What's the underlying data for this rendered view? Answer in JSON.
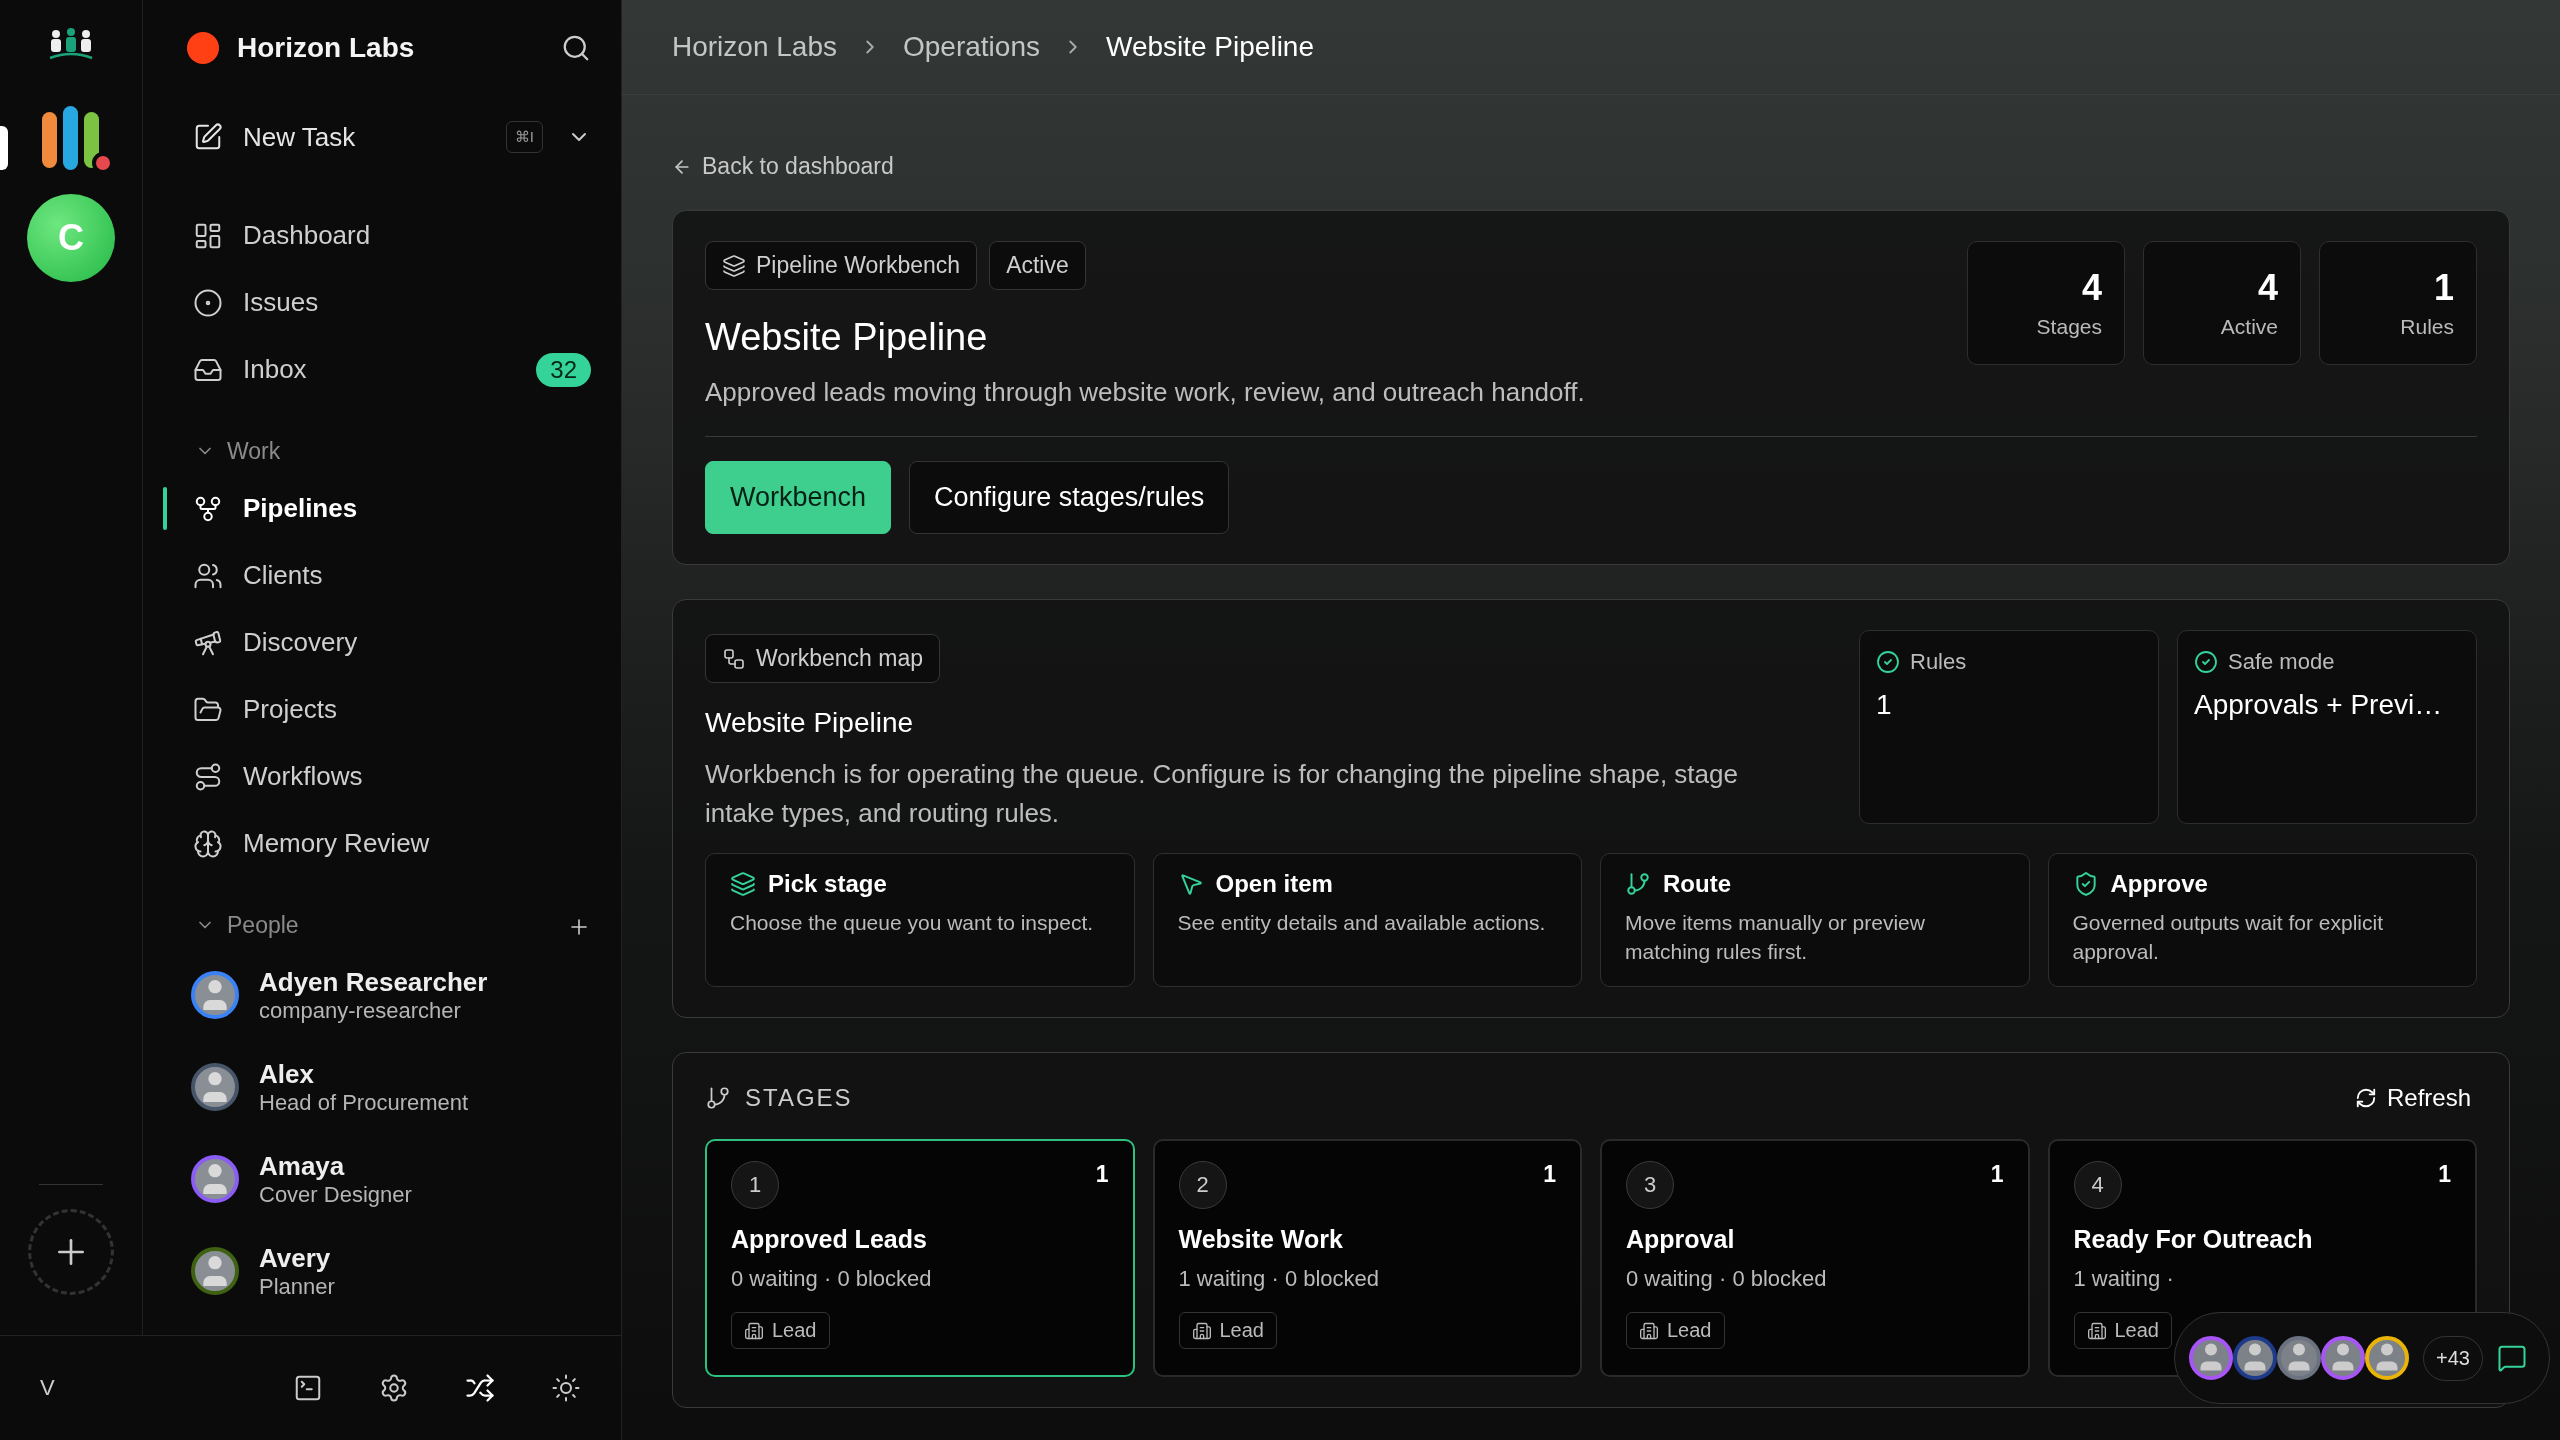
{
  "rail": {
    "notification": true,
    "avatar": "C"
  },
  "workspace": {
    "name": "Horizon Labs",
    "color": "#ff4015"
  },
  "new_task": {
    "label": "New Task",
    "shortcut": "⌘I"
  },
  "nav": [
    {
      "label": "Dashboard",
      "selected": false
    },
    {
      "label": "Issues",
      "selected": false
    },
    {
      "label": "Inbox",
      "selected": false,
      "badge": "32"
    }
  ],
  "work": {
    "title": "Work",
    "expanded": true,
    "items": [
      {
        "label": "Pipelines",
        "selected": true
      },
      {
        "label": "Clients",
        "selected": false
      },
      {
        "label": "Discovery",
        "selected": false
      },
      {
        "label": "Projects",
        "selected": false
      },
      {
        "label": "Workflows",
        "selected": false
      },
      {
        "label": "Memory Review",
        "selected": false
      }
    ]
  },
  "people": {
    "title": "People",
    "expanded": true,
    "items": [
      {
        "name": "Adyen Researcher",
        "role": "company-researcher",
        "color": "#3b82f6"
      },
      {
        "name": "Alex",
        "role": "Head of Procurement",
        "color": "#475569"
      },
      {
        "name": "Amaya",
        "role": "Cover Designer",
        "color": "#8b5cf6"
      },
      {
        "name": "Avery",
        "role": "Planner",
        "color": "#3f6212"
      }
    ]
  },
  "footer": {
    "label": "V"
  },
  "breadcrumb": [
    "Horizon Labs",
    "Operations",
    "Website Pipeline"
  ],
  "back_link": "Back to dashboard",
  "header": {
    "badges": [
      "Pipeline Workbench",
      "Active"
    ],
    "title": "Website Pipeline",
    "description": "Approved leads moving through website work, review, and outreach handoff.",
    "stats": [
      {
        "value": "4",
        "label": "Stages"
      },
      {
        "value": "4",
        "label": "Active"
      },
      {
        "value": "1",
        "label": "Rules"
      }
    ],
    "tabs": [
      {
        "label": "Workbench",
        "selected": true
      },
      {
        "label": "Configure stages/rules",
        "selected": false
      }
    ]
  },
  "map": {
    "badge": "Workbench map",
    "title": "Website Pipeline",
    "description": "Workbench is for operating the queue. Configure is for changing the pipeline shape, stage intake types, and routing rules.",
    "info": [
      {
        "label": "Rules",
        "value": "1"
      },
      {
        "label": "Safe mode",
        "value": "Approvals + Previ…"
      }
    ],
    "steps": [
      {
        "title": "Pick stage",
        "text": "Choose the queue you want to inspect."
      },
      {
        "title": "Open item",
        "text": "See entity details and available actions."
      },
      {
        "title": "Route",
        "text": "Move items manually or preview matching rules first."
      },
      {
        "title": "Approve",
        "text": "Governed outputs wait for explicit approval."
      }
    ]
  },
  "stages": {
    "title": "STAGES",
    "refresh": "Refresh",
    "items": [
      {
        "number": "1",
        "count": "1",
        "name": "Approved Leads",
        "stats": "0 waiting · 0 blocked",
        "tag": "Lead",
        "selected": true
      },
      {
        "number": "2",
        "count": "1",
        "name": "Website Work",
        "stats": "1 waiting · 0 blocked",
        "tag": "Lead",
        "selected": false
      },
      {
        "number": "3",
        "count": "1",
        "name": "Approval",
        "stats": "0 waiting · 0 blocked",
        "tag": "Lead",
        "selected": false
      },
      {
        "number": "4",
        "count": "1",
        "name": "Ready For Outreach",
        "stats": "1 waiting ·",
        "tag": "Lead",
        "selected": false
      }
    ]
  },
  "presence": {
    "avatars": [
      {
        "color": "#a855f7"
      },
      {
        "color": "#1e3a8a"
      },
      {
        "color": "#6b7280"
      },
      {
        "color": "#a855f7"
      },
      {
        "color": "#eab308"
      }
    ],
    "more": "+43"
  }
}
